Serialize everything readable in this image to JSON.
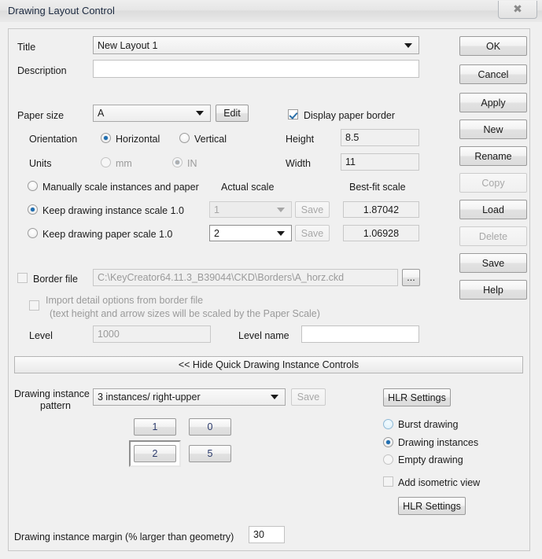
{
  "window": {
    "title": "Drawing Layout Control",
    "close_icon": "close-x-icon"
  },
  "form": {
    "title_label": "Title",
    "title_value": "New Layout 1",
    "description_label": "Description",
    "description_value": "",
    "paper_size_label": "Paper size",
    "paper_size_value": "A",
    "edit_button": "Edit",
    "display_paper_border_label": "Display paper border",
    "orientation_label": "Orientation",
    "orientation_horizontal": "Horizontal",
    "orientation_vertical": "Vertical",
    "units_label": "Units",
    "units_mm": "mm",
    "units_in": "IN",
    "height_label": "Height",
    "height_value": "8.5",
    "width_label": "Width",
    "width_value": "11"
  },
  "scale": {
    "manual_label": "Manually scale instances and paper",
    "keep_instance_label": "Keep drawing instance scale 1.0",
    "keep_paper_label": "Keep drawing paper scale 1.0",
    "actual_scale_header": "Actual scale",
    "best_fit_header": "Best-fit scale",
    "instance_actual": "1",
    "paper_actual": "2",
    "instance_best_fit": "1.87042",
    "paper_best_fit": "1.06928",
    "save_label": "Save"
  },
  "border": {
    "border_file_label": "Border file",
    "border_file_path": "C:\\KeyCreator64.11.3_B39044\\CKD\\Borders\\A_horz.ckd",
    "browse_label": "...",
    "import_detail_line1": "Import detail options from border file",
    "import_detail_line2": "(text height and arrow sizes will be scaled by the Paper Scale)",
    "level_label": "Level",
    "level_value": "1000",
    "level_name_label": "Level name",
    "level_name_value": ""
  },
  "quick": {
    "hide_bar_label": "<< Hide Quick Drawing Instance Controls",
    "pattern_label_line1": "Drawing instance",
    "pattern_label_line2": "pattern",
    "pattern_value": "3 instances/ right-upper",
    "save_label": "Save",
    "grid_buttons": [
      "1",
      "0",
      "2",
      "5"
    ],
    "selected_grid_button": "2"
  },
  "right_options": {
    "hlr_settings_top": "HLR Settings",
    "burst_drawing": "Burst drawing",
    "drawing_instances": "Drawing instances",
    "empty_drawing": "Empty drawing",
    "add_isometric_view": "Add isometric view",
    "hlr_settings_bottom": "HLR Settings"
  },
  "margin": {
    "label": "Drawing instance margin (% larger than geometry)",
    "value": "30"
  },
  "buttons": {
    "ok": "OK",
    "cancel": "Cancel",
    "apply": "Apply",
    "new": "New",
    "rename": "Rename",
    "copy": "Copy",
    "load": "Load",
    "delete": "Delete",
    "save": "Save",
    "help": "Help"
  }
}
